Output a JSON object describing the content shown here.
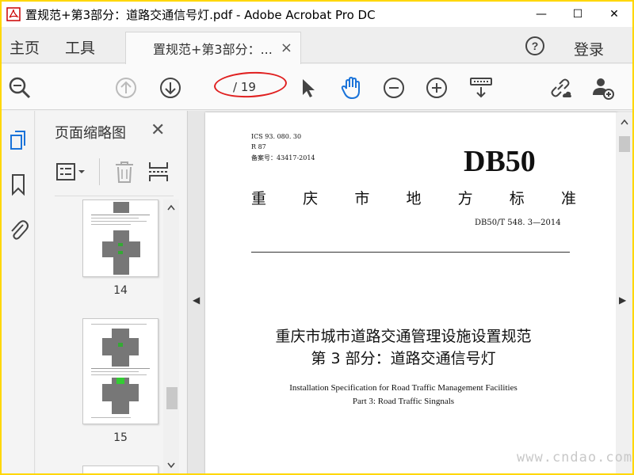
{
  "window": {
    "title": "置规范+第3部分：道路交通信号灯.pdf - Adobe Acrobat Pro DC",
    "minimize": "—",
    "maximize": "☐",
    "close": "✕"
  },
  "nav": {
    "home": "主页",
    "tools": "工具",
    "tab_label": "置规范+第3部分：...",
    "tab_close": "×",
    "login": "登录"
  },
  "toolbar": {
    "page_current": "",
    "page_total": "/ 19"
  },
  "panel": {
    "title": "页面缩略图",
    "close": "✕",
    "thumbs": [
      {
        "label": "14"
      },
      {
        "label": "15"
      }
    ]
  },
  "document": {
    "meta": [
      "ICS 93. 080. 30",
      "R 87",
      "备案号：43417-2014"
    ],
    "logo": "DB50",
    "std_title_chars": [
      "重",
      "庆",
      "市",
      "地",
      "方",
      "标",
      "准"
    ],
    "std_code": "DB50/T 548. 3—2014",
    "main_title": "重庆市城市道路交通管理设施设置规范",
    "sub_title": "第 3 部分：道路交通信号灯",
    "en_title_1": "Installation Specification for Road Traffic Management Facilities",
    "en_title_2": "Part 3: Road Traffic Singnals"
  },
  "watermark": "www.cndao.com"
}
